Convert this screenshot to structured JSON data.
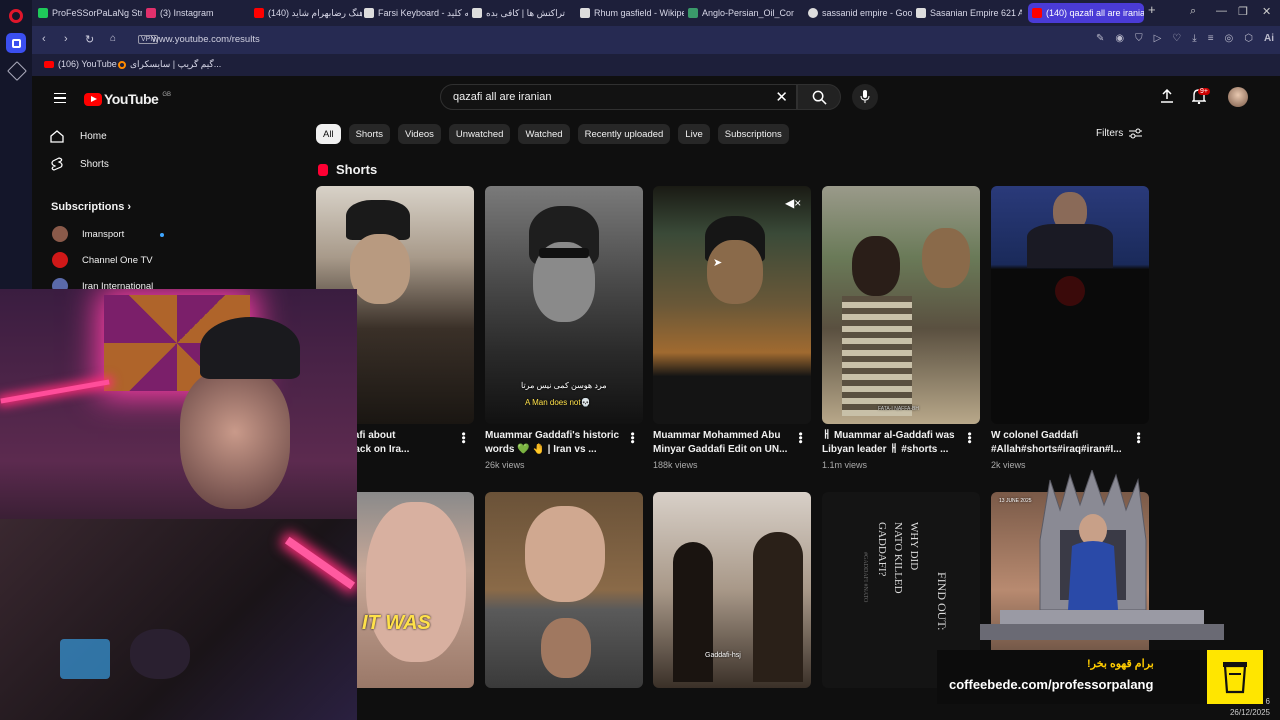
{
  "browser": {
    "tabs": [
      {
        "label": "ProFeSSorPaLaNg Stream",
        "color": "#1fc95a"
      },
      {
        "label": "(3) Instagram",
        "color": "#e1306c"
      },
      {
        "label": "(140) آهنگ رضابهرام شاید",
        "color": "#ff0000"
      },
      {
        "label": "Farsi Keyboard - تخته کلید",
        "color": "#ffffff"
      },
      {
        "label": "تراکتش ها | کافی بده",
        "color": "#ffffff"
      },
      {
        "label": "Rhum gasfield - Wikiped",
        "color": "#ffffff"
      },
      {
        "label": "Anglo-Persian_Oil_Comp",
        "color": "#3a9a6a"
      },
      {
        "label": "sassanid empire - Googl",
        "color": "#ffffff"
      },
      {
        "label": "Sasanian Empire 621 A.D",
        "color": "#ffffff"
      },
      {
        "label": "(140) qazafi all are iranian",
        "color": "#ff0000"
      }
    ],
    "new_tab": "+",
    "vpn": "VPN",
    "url": "www.youtube.com/results",
    "bookmarks": [
      {
        "label": "(106) YouTube",
        "color": "#ff0000"
      },
      {
        "label": "گیم گریپ | سایسکرای...",
        "color": "#ff8a00"
      }
    ],
    "ai_label": "Ai"
  },
  "youtube": {
    "logo": "YouTube",
    "country": "GB",
    "search_query": "qazafi all are iranian",
    "notifications": "9+",
    "sidebar": {
      "items": [
        {
          "label": "Home"
        },
        {
          "label": "Shorts"
        }
      ],
      "subscriptions_title": "Subscriptions",
      "channels": [
        {
          "label": "Imansport",
          "color": "#8a5a4a"
        },
        {
          "label": "Channel One TV",
          "color": "#d01818"
        },
        {
          "label": "Iran International",
          "color": "#5a6aaa"
        }
      ]
    },
    "chips": [
      "All",
      "Shorts",
      "Videos",
      "Unwatched",
      "Watched",
      "Recently uploaded",
      "Live",
      "Subscriptions"
    ],
    "filters_label": "Filters",
    "shorts_heading": "Shorts",
    "shorts": [
      {
        "title_line1": "ar Gaddafi about",
        "title_line2": "srael attack on Ira...",
        "views": ""
      },
      {
        "title_line1": "Muammar Gaddafi's historic",
        "title_line2": "words 💚 🤚 | Iran vs ...",
        "views": "26k views"
      },
      {
        "title_line1": "Muammar Mohammed Abu",
        "title_line2": "Minyar Gaddafi Edit on UN...",
        "views": "188k views"
      },
      {
        "title_line1": "ㅐ Muammar al-Gaddafi was",
        "title_line2": "Libyan leader ㅐ #shorts ...",
        "views": "1.1m views"
      },
      {
        "title_line1": "W colonel Gaddafi",
        "title_line2": "#Allah#shorts#iraq#iran#I...",
        "views": "2k views"
      }
    ],
    "thumb_text": {
      "short2_fa": "مرد هوسن کمی نیس مرتا",
      "short2_en": "A Man does not💀",
      "row2_it_was": "IT WAS",
      "row2_gaddafi": "Gaddafi-hsj",
      "row2_findout": "FIND OUT:",
      "row2_why": "WHY DID",
      "row2_nato": "NATO KILLED",
      "row2_gad": "GADDAFI?",
      "row2_hash": "#GADDAFI #NATO",
      "row2_date": "13 JUNE 2025",
      "short4_caption": "FATA-I NAFFA-BH"
    }
  },
  "overlay": {
    "coffee_fa": "برام قهوه بخر!",
    "coffee_link": "coffeebede.com/professorpalang",
    "clock_time": "6",
    "clock_date": "26/12/2025"
  }
}
